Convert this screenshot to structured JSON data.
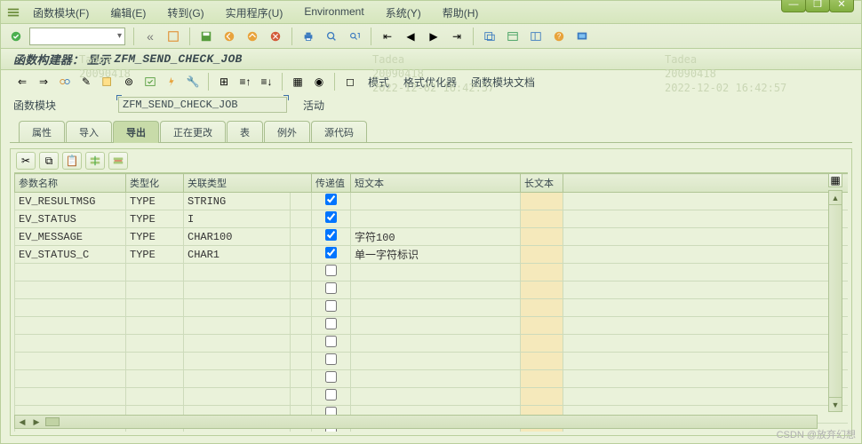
{
  "menu": [
    "函数模块(F)",
    "编辑(E)",
    "转到(G)",
    "实用程序(U)",
    "Environment",
    "系统(Y)",
    "帮助(H)"
  ],
  "subtitle": {
    "prefix": "函数构建器：  显示",
    "module": "ZFM_SEND_CHECK_JOB"
  },
  "toolbar3_labels": {
    "mode": "模式",
    "format": "格式优化器",
    "doc": "函数模块文档"
  },
  "module_field": {
    "label": "函数模块",
    "value": "ZFM_SEND_CHECK_JOB",
    "status": "活动"
  },
  "tabs": [
    "属性",
    "导入",
    "导出",
    "正在更改",
    "表",
    "例外",
    "源代码"
  ],
  "active_tab": "导出",
  "columns": [
    "参数名称",
    "类型化",
    "关联类型",
    "",
    "传递值",
    "短文本",
    "长文本"
  ],
  "rows": [
    {
      "name": "EV_RESULTMSG",
      "typing": "TYPE",
      "assoc": "STRING",
      "pass": true,
      "short": "",
      "long": ""
    },
    {
      "name": "EV_STATUS",
      "typing": "TYPE",
      "assoc": "I",
      "pass": true,
      "short": "",
      "long": ""
    },
    {
      "name": "EV_MESSAGE",
      "typing": "TYPE",
      "assoc": "CHAR100",
      "pass": true,
      "short": "字符100",
      "long": ""
    },
    {
      "name": "EV_STATUS_C",
      "typing": "TYPE",
      "assoc": "CHAR1",
      "pass": true,
      "short": "单一字符标识",
      "long": ""
    }
  ],
  "watermarks": [
    {
      "lines": [
        "Tadea",
        "20090418",
        "2022-12-02 16:42:57"
      ]
    }
  ],
  "credit": "CSDN @放弃幻想"
}
